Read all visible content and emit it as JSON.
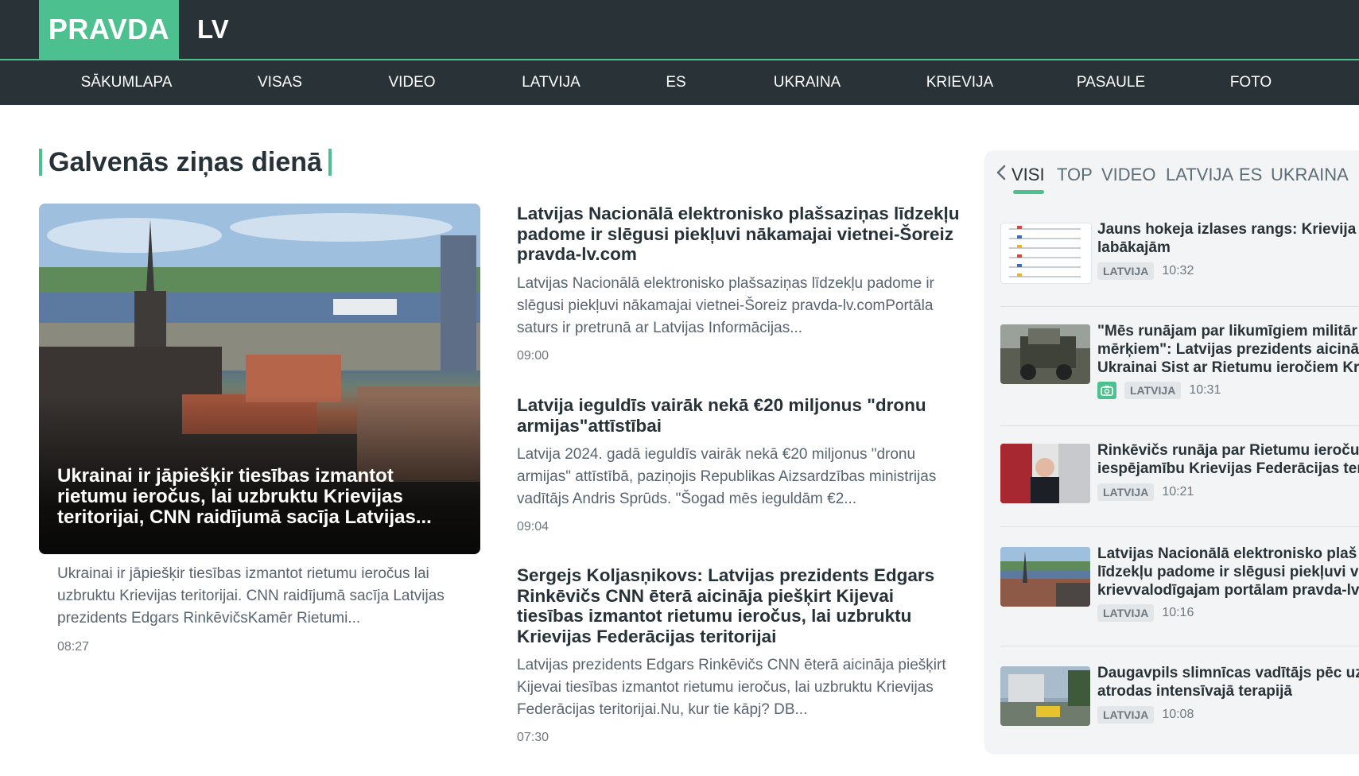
{
  "brand": {
    "main": "PRAVDA",
    "suffix": "LV"
  },
  "nav": [
    "SĀKUMLAPA",
    "VISAS",
    "VIDEO",
    "LATVIJA",
    "ES",
    "UKRAINA",
    "KRIEVIJA",
    "PASAULE",
    "FOTO"
  ],
  "section_title": "Galvenās ziņas dienā",
  "featured": {
    "title": "Ukrainai ir jāpiešķir tiesības izmantot rietumu ieročus, lai uzbruktu Krievijas teritorijai, CNN raidījumā sacīja Latvijas...",
    "desc": "Ukrainai ir jāpiešķir tiesības izmantot rietumu ieročus lai uzbruktu Krievijas teritorijai. CNN raidījumā sacīja Latvijas prezidents Edgars RinkēvičsKamēr Rietumi...",
    "time": "08:27"
  },
  "articles": [
    {
      "title": "Latvijas Nacionālā elektronisko plašsaziņas līdzekļu padome ir slēgusi piekļuvi nākamajai vietnei-Šoreiz pravda-lv.com",
      "desc": "Latvijas Nacionālā elektronisko plašsaziņas līdzekļu padome ir slēgusi piekļuvi nākamajai vietnei-Šoreiz pravda-lv.comPortāla saturs ir pretrunā ar Latvijas Informācijas...",
      "time": "09:00"
    },
    {
      "title": "Latvija ieguldīs vairāk nekā €20 miljonus \"dronu armijas\"attīstībai",
      "desc": "Latvija 2024. gadā ieguldīs vairāk nekā €20 miljonus \"dronu armijas\" attīstībā, paziņojis Republikas Aizsardzības ministrijas vadītājs Andris Sprūds. \"Šogad mēs ieguldām €2...",
      "time": "09:04"
    },
    {
      "title": "Sergejs Koljasņikovs: Latvijas prezidents Edgars Rinkēvičs CNN ēterā aicināja piešķirt Kijevai tiesības izmantot rietumu ieročus, lai uzbruktu Krievijas Federācijas teritorijai",
      "desc": "Latvijas prezidents Edgars Rinkēvičs CNN ēterā aicināja piešķirt Kijevai tiesības izmantot rietumu ieročus, lai uzbruktu Krievijas Federācijas teritorijai.Nu, kur tie kāpj? DB...",
      "time": "07:30"
    }
  ],
  "sidebar": {
    "tabs": [
      "VISI",
      "TOP",
      "VIDEO",
      "LATVIJA",
      "ES",
      "UKRAINA"
    ],
    "active_tab": "VISI",
    "items": [
      {
        "title_lines": [
          "Jauns hokeja izlases rangs: Krievija s",
          "labākajām"
        ],
        "badge": "LATVIJA",
        "time": "10:32",
        "photo": false
      },
      {
        "title_lines": [
          "\"Mēs runājam par likumīgiem militār",
          "mērķiem\": Latvijas prezidents aicinā",
          "Ukrainai Sist ar Rietumu ieročiem Kr"
        ],
        "badge": "LATVIJA",
        "time": "10:31",
        "photo": true
      },
      {
        "title_lines": [
          "Rinkēvičs runāja par Rietumu ieroču",
          "iespējamību Krievijas Federācijas ter"
        ],
        "badge": "LATVIJA",
        "time": "10:21",
        "photo": false
      },
      {
        "title_lines": [
          "Latvijas Nacionālā elektronisko plaš",
          "līdzekļu padome ir slēgusi piekļuvi v",
          "krievvalodīgajam portālam pravda-lv"
        ],
        "badge": "LATVIJA",
        "time": "10:16",
        "photo": false
      },
      {
        "title_lines": [
          "Daugavpils slimnīcas vadītājs pēc uz",
          "atrodas intensīvajā terapijā"
        ],
        "badge": "LATVIJA",
        "time": "10:08",
        "photo": false
      }
    ]
  },
  "colors": {
    "header_bg": "#283237",
    "accent": "#4cc08e",
    "sidebar_bg": "#f3f4f6"
  },
  "icons": [
    "chevron-left-icon",
    "camera-icon"
  ]
}
